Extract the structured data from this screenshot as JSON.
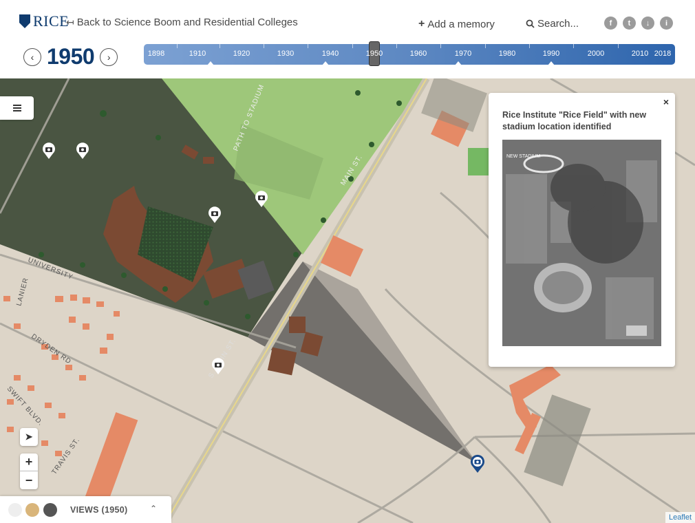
{
  "header": {
    "logo_text": "RICE",
    "back_link": "Back to Science Boom and Residential Colleges",
    "add_memory": "Add a memory",
    "search_placeholder": "Search...",
    "social": [
      "f",
      "t",
      "↓",
      "i"
    ]
  },
  "year_nav": {
    "year": "1950"
  },
  "timeline": {
    "labels": [
      "1898",
      "1910",
      "1920",
      "1930",
      "1940",
      "1950",
      "1960",
      "1970",
      "1980",
      "1990",
      "2000",
      "2010",
      "2018"
    ],
    "selected_year": "1950"
  },
  "map": {
    "street_labels": [
      "PATH TO STADIUM",
      "UNIVERSITY",
      "LANIER",
      "DRYDEN RD",
      "SWIFT BLVD.",
      "TRAVIS ST.",
      "S. MAIN ST.",
      "MAIN ST."
    ]
  },
  "popup": {
    "title": "Rice Institute \"Rice Field\" with new stadium location identified",
    "photo_label": "NEW STADIUM",
    "close": "×"
  },
  "views": {
    "label": "VIEWS (1950)"
  },
  "attribution": "Leaflet",
  "colors": {
    "brand": "#0f3b6e",
    "timeline_start": "#7ca1d3",
    "timeline_end": "#2e65ad",
    "marker_active": "#1a4a8a"
  }
}
